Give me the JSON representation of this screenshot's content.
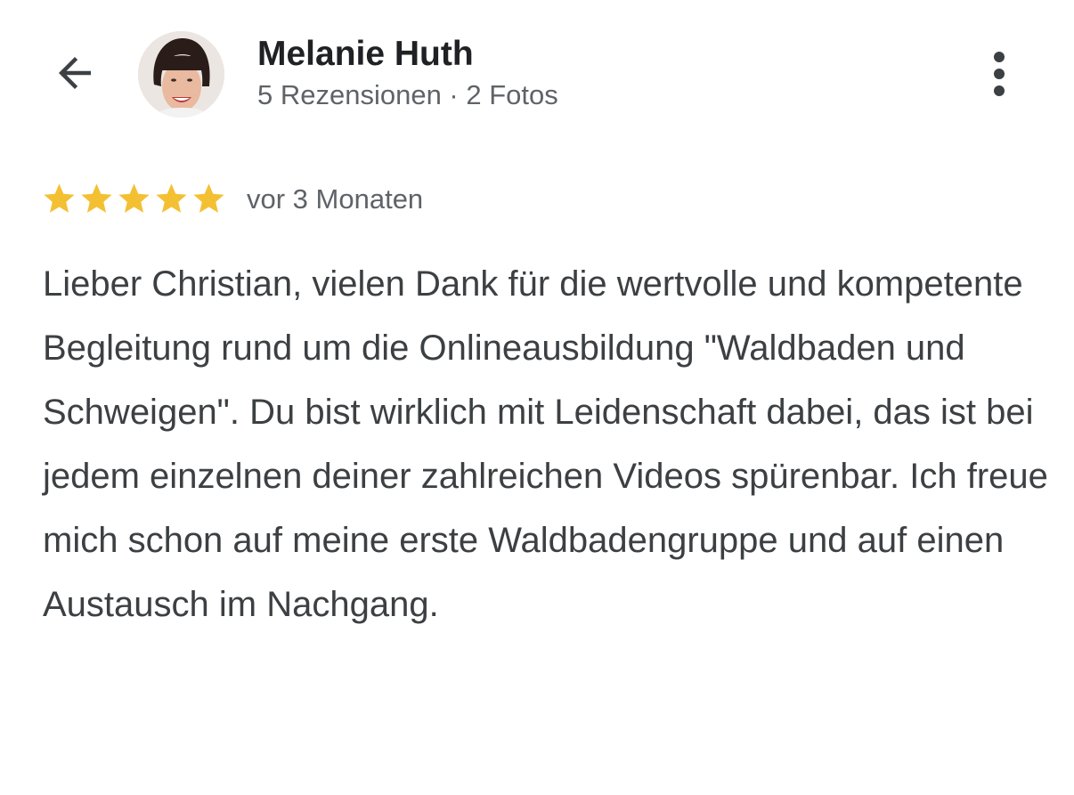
{
  "header": {
    "back_icon": "arrow-back-icon",
    "menu_icon": "more-vertical-icon"
  },
  "reviewer": {
    "name": "Melanie Huth",
    "meta": "5 Rezensionen · 2 Fotos",
    "avatar_icon": "profile-photo"
  },
  "review": {
    "rating": 5,
    "rating_max": 5,
    "star_color": "#f4c033",
    "date": "vor 3 Monaten",
    "text": "Lieber Christian, vielen Dank für die wertvolle und kompetente Begleitung rund um die Onlineausbildung \"Waldbaden und Schweigen\". Du bist wirklich mit Leidenschaft dabei, das ist bei jedem einzelnen deiner zahlreichen Videos spürenbar. Ich freue mich schon auf meine erste Waldbadengruppe und auf einen Austausch im Nachgang."
  }
}
